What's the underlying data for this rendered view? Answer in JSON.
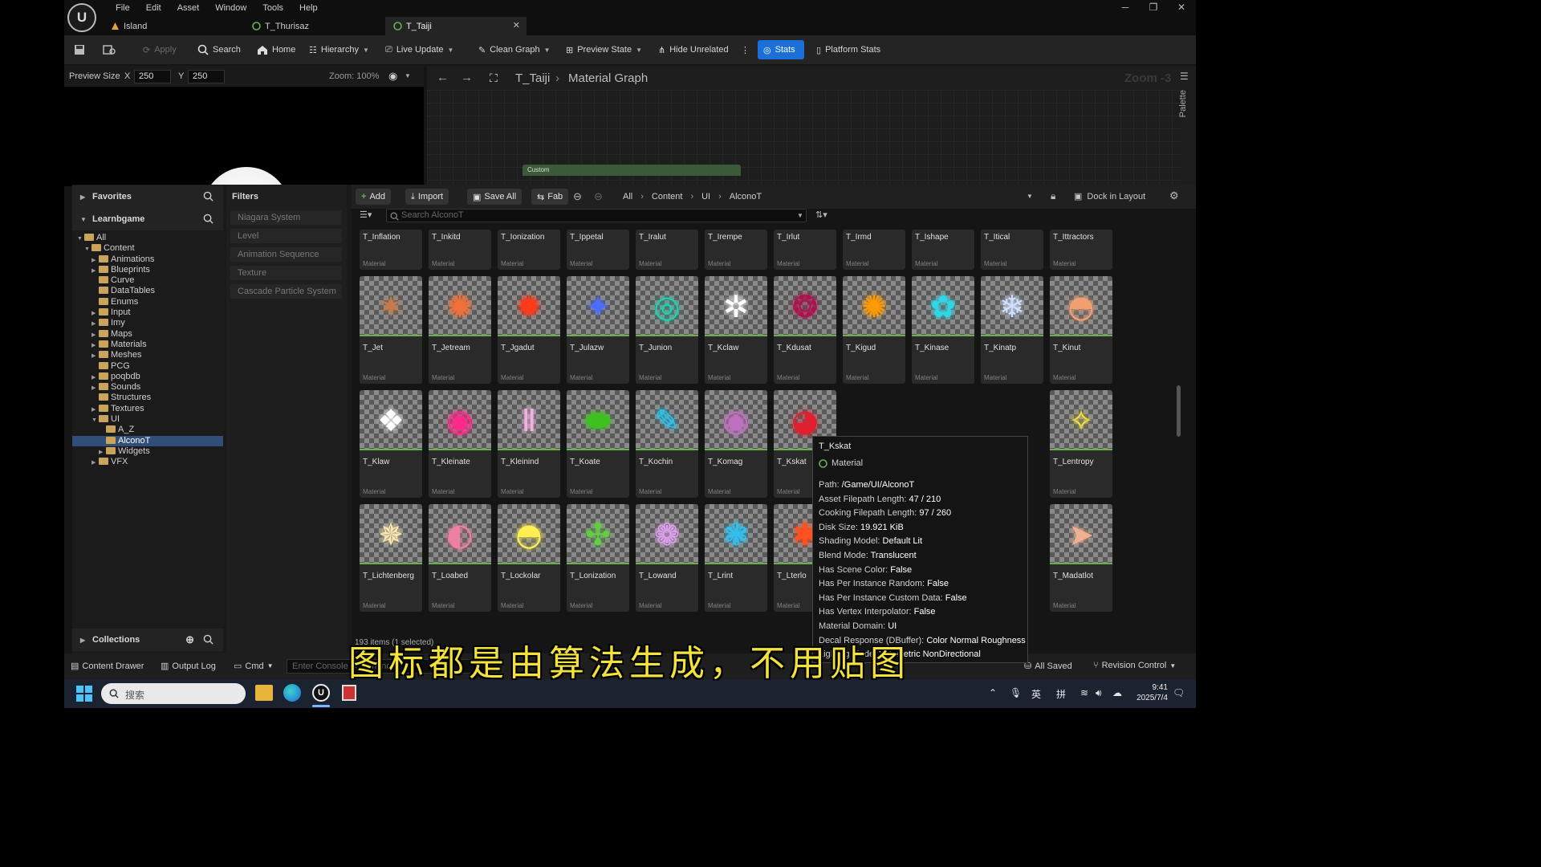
{
  "menu": [
    "File",
    "Edit",
    "Asset",
    "Window",
    "Tools",
    "Help"
  ],
  "tabs": [
    {
      "label": "Island",
      "icon": "level-icon"
    },
    {
      "label": "T_Thurisaz",
      "icon": "material-icon"
    },
    {
      "label": "T_Taiji",
      "icon": "material-icon",
      "active": true
    }
  ],
  "toolbar": {
    "apply": "Apply",
    "search": "Search",
    "home": "Home",
    "hierarchy": "Hierarchy",
    "live_update": "Live Update",
    "clean_graph": "Clean Graph",
    "preview_state": "Preview State",
    "hide_unrelated": "Hide Unrelated",
    "stats": "Stats",
    "platform_stats": "Platform Stats"
  },
  "preview": {
    "size_label": "Preview Size",
    "x_label": "X",
    "x_value": "250",
    "y_label": "Y",
    "y_value": "250",
    "zoom": "Zoom: 100%"
  },
  "graph": {
    "asset": "T_Taiji",
    "title": "Material Graph",
    "zoom": "Zoom -3",
    "palette": "Palette",
    "node_title": "Custom"
  },
  "sidebar": {
    "favorites": "Favorites",
    "project": "Learnbgame",
    "collections": "Collections",
    "tree": [
      {
        "label": "All",
        "depth": 0,
        "arrow": "▼"
      },
      {
        "label": "Content",
        "depth": 1,
        "arrow": "▼"
      },
      {
        "label": "Animations",
        "depth": 2,
        "arrow": "▶"
      },
      {
        "label": "Blueprints",
        "depth": 2,
        "arrow": "▶"
      },
      {
        "label": "Curve",
        "depth": 2,
        "arrow": ""
      },
      {
        "label": "DataTables",
        "depth": 2,
        "arrow": ""
      },
      {
        "label": "Enums",
        "depth": 2,
        "arrow": ""
      },
      {
        "label": "Input",
        "depth": 2,
        "arrow": "▶"
      },
      {
        "label": "Imy",
        "depth": 2,
        "arrow": "▶"
      },
      {
        "label": "Maps",
        "depth": 2,
        "arrow": "▶"
      },
      {
        "label": "Materials",
        "depth": 2,
        "arrow": "▶"
      },
      {
        "label": "Meshes",
        "depth": 2,
        "arrow": "▶"
      },
      {
        "label": "PCG",
        "depth": 2,
        "arrow": ""
      },
      {
        "label": "poqbdb",
        "depth": 2,
        "arrow": "▶"
      },
      {
        "label": "Sounds",
        "depth": 2,
        "arrow": "▶"
      },
      {
        "label": "Structures",
        "depth": 2,
        "arrow": ""
      },
      {
        "label": "Textures",
        "depth": 2,
        "arrow": "▶"
      },
      {
        "label": "UI",
        "depth": 2,
        "arrow": "▼"
      },
      {
        "label": "A_Z",
        "depth": 3,
        "arrow": ""
      },
      {
        "label": "AlconoT",
        "depth": 3,
        "arrow": "",
        "selected": true
      },
      {
        "label": "Widgets",
        "depth": 3,
        "arrow": "▶"
      },
      {
        "label": "VFX",
        "depth": 2,
        "arrow": "▶"
      }
    ]
  },
  "filters": {
    "title": "Filters",
    "items": [
      "Niagara System",
      "Level",
      "Animation Sequence",
      "Texture",
      "Cascade Particle System"
    ]
  },
  "browser": {
    "add": "Add",
    "import": "Import",
    "save_all": "Save All",
    "fab": "Fab",
    "path": [
      "All",
      "Content",
      "UI",
      "AlconoT"
    ],
    "dock": "Dock in Layout",
    "search_placeholder": "Search AlconoT",
    "count": "193 items (1 selected)",
    "type_label": "Material",
    "row0": [
      "T_Inflation",
      "T_Inkitd",
      "T_Ionization",
      "T_Ippetal",
      "T_Iralut",
      "T_Irempe",
      "T_Irlut",
      "T_Irmd",
      "T_Ishape",
      "T_Itical",
      "T_Ittractors"
    ],
    "row1": [
      "T_Jet",
      "T_Jetream",
      "T_Jgadut",
      "T_Julazw",
      "T_Junion",
      "T_Kclaw",
      "T_Kdusat",
      "T_Kigud",
      "T_Kinase",
      "T_Kinatp",
      "T_Kinut"
    ],
    "row2": [
      "T_Klaw",
      "T_Kleinate",
      "T_Kleinind",
      "T_Koate",
      "T_Kochin",
      "T_Komag",
      "T_Kskat",
      "",
      "",
      "",
      "T_Lentropy"
    ],
    "row3": [
      "T_Lichtenberg",
      "T_Loabed",
      "T_Lockolar",
      "T_Lonization",
      "T_Lowand",
      "T_Lrint",
      "T_Lterlo",
      "",
      "",
      "",
      "T_Madatlot"
    ]
  },
  "tooltip": {
    "title": "T_Kskat",
    "type": "Material",
    "rows": [
      {
        "k": "Path:",
        "v": "/Game/UI/AlconoT"
      },
      {
        "k": "Asset Filepath Length:",
        "v": "47 / 210"
      },
      {
        "k": "Cooking Filepath Length:",
        "v": "97 / 260"
      },
      {
        "k": "Disk Size:",
        "v": "19.921 KiB"
      },
      {
        "k": "Shading Model:",
        "v": "Default Lit"
      },
      {
        "k": "Blend Mode:",
        "v": "Translucent"
      },
      {
        "k": "Has Scene Color:",
        "v": "False"
      },
      {
        "k": "Has Per Instance Random:",
        "v": "False"
      },
      {
        "k": "Has Per Instance Custom Data:",
        "v": "False"
      },
      {
        "k": "Has Vertex Interpolator:",
        "v": "False"
      },
      {
        "k": "Material Domain:",
        "v": "UI"
      },
      {
        "k": "Decal Response (DBuffer):",
        "v": "Color Normal Roughness"
      },
      {
        "k": "Lighting Mode:",
        "v": "Volumetric NonDirectional"
      }
    ]
  },
  "statusbar": {
    "content_drawer": "Content Drawer",
    "output_log": "Output Log",
    "cmd": "Cmd",
    "cmd_placeholder": "Enter Console Command",
    "all_saved": "All Saved",
    "revision": "Revision Control"
  },
  "subtitle": "图标都是由算法生成，不用贴图",
  "taskbar": {
    "search_placeholder": "搜索",
    "time": "9:41",
    "date": "2025/7/4",
    "ime1": "英",
    "ime2": "拼"
  }
}
